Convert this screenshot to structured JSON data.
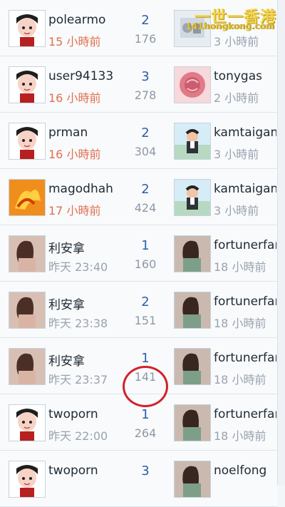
{
  "threads": [
    {
      "left_user": "polearmo",
      "left_time": "15 小時前",
      "left_time_color": "orange",
      "count": "2",
      "views": "176",
      "right_user": "",
      "right_time": "3 小時前",
      "left_avatar": "boy-avatar",
      "right_avatar": "office-avatar"
    },
    {
      "left_user": "user94133",
      "left_time": "16 小時前",
      "left_time_color": "orange",
      "count": "3",
      "views": "278",
      "right_user": "tonygas",
      "right_time": "2 小時前",
      "left_avatar": "boy-avatar",
      "right_avatar": "rose-avatar"
    },
    {
      "left_user": "prman",
      "left_time": "16 小時前",
      "left_time_color": "orange",
      "count": "2",
      "views": "304",
      "right_user": "kamtaigan",
      "right_time": "3 小時前",
      "left_avatar": "boy-avatar",
      "right_avatar": "cartoon-man-avatar"
    },
    {
      "left_user": "magodhaha",
      "left_time": "17 小時前",
      "left_time_color": "orange",
      "count": "2",
      "views": "424",
      "right_user": "kamtaigan",
      "right_time": "3 小時前",
      "left_avatar": "phoenix-avatar",
      "right_avatar": "cartoon-man-avatar"
    },
    {
      "left_user": "利安拿",
      "left_time": "昨天 23:40",
      "left_time_color": "gray",
      "count": "1",
      "views": "160",
      "right_user": "fortunerfam",
      "right_time": "18 小時前",
      "left_avatar": "woman-photo-avatar",
      "right_avatar": "woman-photo-avatar"
    },
    {
      "left_user": "利安拿",
      "left_time": "昨天 23:38",
      "left_time_color": "gray",
      "count": "2",
      "views": "151",
      "right_user": "fortunerfam",
      "right_time": "18 小時前",
      "left_avatar": "woman-photo-avatar",
      "right_avatar": "woman-photo-avatar"
    },
    {
      "left_user": "利安拿",
      "left_time": "昨天 23:37",
      "left_time_color": "gray",
      "count": "1",
      "views": "141",
      "right_user": "fortunerfam",
      "right_time": "18 小時前",
      "left_avatar": "woman-photo-avatar",
      "right_avatar": "woman-photo-avatar"
    },
    {
      "left_user": "twoporn",
      "left_time": "昨天 22:00",
      "left_time_color": "gray",
      "count": "1",
      "views": "264",
      "right_user": "fortunerfam",
      "right_time": "18 小時前",
      "left_avatar": "boy-avatar",
      "right_avatar": "woman-photo-avatar"
    },
    {
      "left_user": "twoporn",
      "left_time": "",
      "left_time_color": "gray",
      "count": "3",
      "views": "",
      "right_user": "noelfong",
      "right_time": "",
      "left_avatar": "boy-avatar",
      "right_avatar": "woman-photo-avatar"
    }
  ],
  "watermark": {
    "title": "一世一香港",
    "url": "141hongkong.com"
  },
  "colors": {
    "orange": "#e26f4f",
    "gray": "#9aa3ad",
    "count_blue": "#2d5fa8",
    "annotation_red": "#d3202a"
  }
}
